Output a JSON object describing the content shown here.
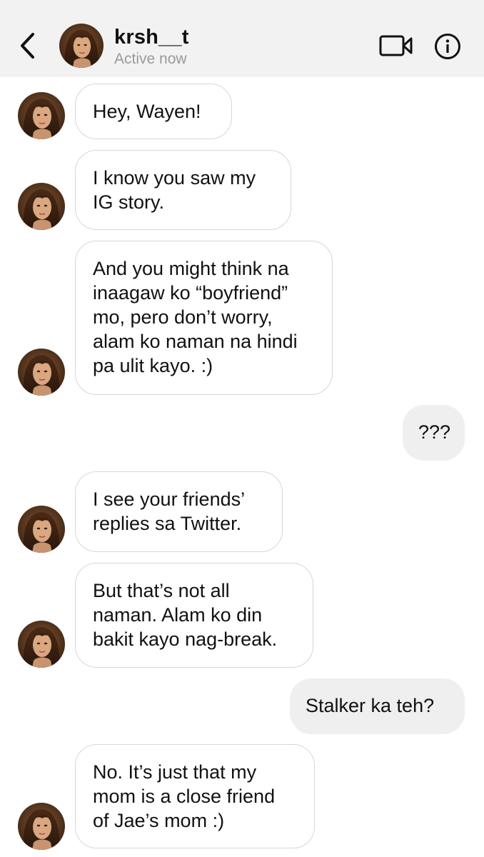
{
  "header": {
    "username": "krsh__t",
    "status": "Active now",
    "back_icon": "chevron-left-icon",
    "video_icon": "video-call-icon",
    "info_icon": "info-icon"
  },
  "colors": {
    "header_bg": "#f2f2f2",
    "incoming_bubble_border": "#d7d7d7",
    "outgoing_bubble_bg": "#efefef",
    "status_text": "#9a9a9a"
  },
  "messages": [
    {
      "sender": "krsh__t",
      "direction": "incoming",
      "text": "Hey, Wayen!"
    },
    {
      "sender": "krsh__t",
      "direction": "incoming",
      "text": "I know you saw my\nIG story."
    },
    {
      "sender": "krsh__t",
      "direction": "incoming",
      "text": "And you might think na\ninaagaw ko “boyfriend”\nmo, pero don’t worry,\nalam ko naman na hindi\npa ulit kayo. :)"
    },
    {
      "sender": "me",
      "direction": "outgoing",
      "text": "???"
    },
    {
      "sender": "krsh__t",
      "direction": "incoming",
      "text": "I see your friends’\nreplies sa Twitter."
    },
    {
      "sender": "krsh__t",
      "direction": "incoming",
      "text": "But that’s not all\nnaman. Alam ko din\nbakit kayo nag-break."
    },
    {
      "sender": "me",
      "direction": "outgoing",
      "text": "Stalker ka teh?"
    },
    {
      "sender": "krsh__t",
      "direction": "incoming",
      "text": "No. It’s just that my\nmom is a close friend\nof Jae’s mom :)"
    }
  ]
}
